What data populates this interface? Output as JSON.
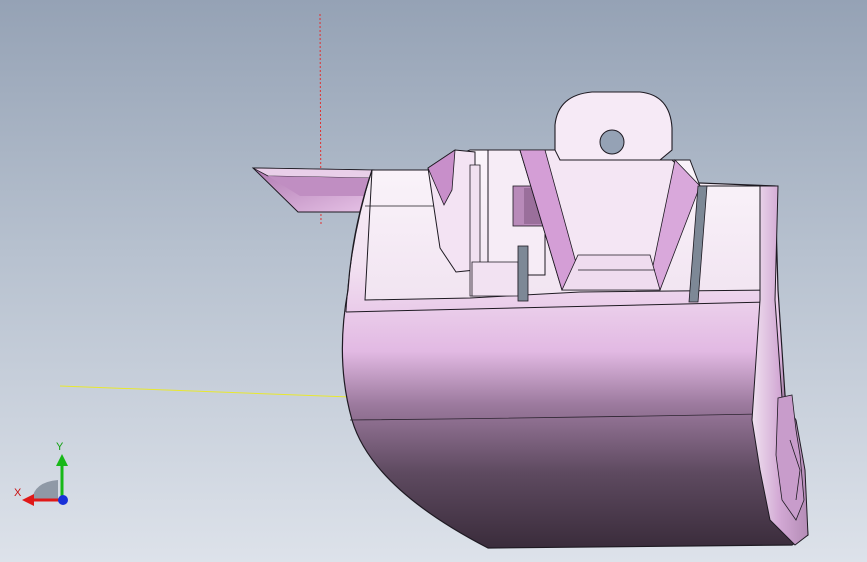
{
  "viewport": {
    "background_top": "#95a2b5",
    "background_bottom": "#dde2ea"
  },
  "model": {
    "body_color_light": "#f4e4f2",
    "body_color_mid": "#d9b3da",
    "body_color_dark": "#3f3040",
    "pocket_color": "#d8a0d8",
    "slot_color": "#7d8896",
    "edge_color": "#1e1a22"
  },
  "reference_lines": {
    "vertical_color": "#e03030",
    "horizontal_color": "#e8e830"
  },
  "triad": {
    "x_label": "X",
    "y_label": "Y",
    "x_color": "#e01818",
    "y_color": "#18b818",
    "z_color": "#1830d8",
    "x_label_color": "#c81010",
    "y_label_color": "#10a010"
  }
}
